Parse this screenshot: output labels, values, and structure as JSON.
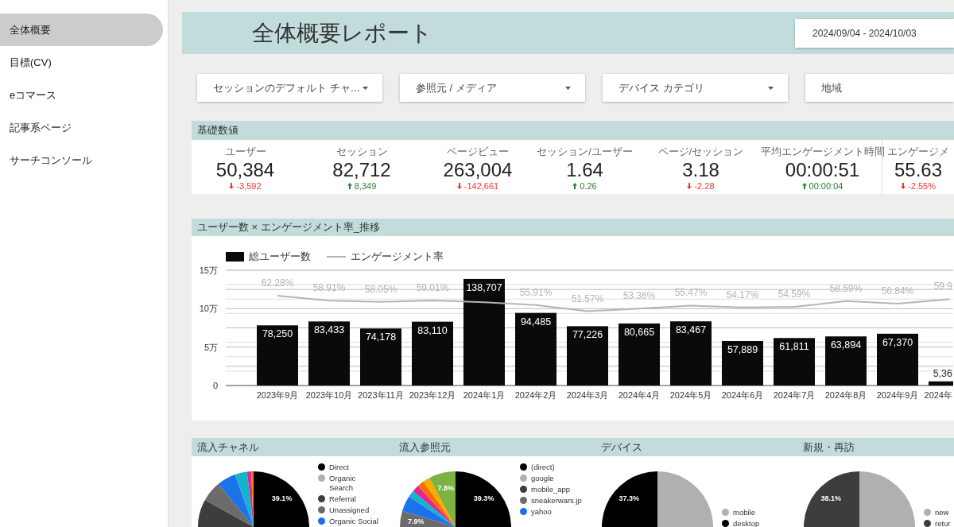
{
  "sidebar": {
    "items": [
      {
        "label": "全体概要",
        "selected": true
      },
      {
        "label": "目標(CV)",
        "selected": false
      },
      {
        "label": "eコマース",
        "selected": false
      },
      {
        "label": "記事系ページ",
        "selected": false
      },
      {
        "label": "サーチコンソール",
        "selected": false
      }
    ]
  },
  "header": {
    "title": "全体概要レポート",
    "date_range": "2024/09/04 - 2024/10/03"
  },
  "filters": [
    {
      "label": "セッションのデフォルト チャ…",
      "dropdown": true
    },
    {
      "label": "参照元 / メディア",
      "dropdown": true
    },
    {
      "label": "デバイス カテゴリ",
      "dropdown": true
    },
    {
      "label": "地域",
      "dropdown": false
    }
  ],
  "kpi": {
    "title": "基礎数値",
    "cards": [
      {
        "label": "ユーザー",
        "value": "50,384",
        "delta": "-3,592",
        "rising": false
      },
      {
        "label": "セッション",
        "value": "82,712",
        "delta": "8,349",
        "rising": true
      },
      {
        "label": "ページビュー",
        "value": "263,004",
        "delta": "-142,661",
        "rising": false
      },
      {
        "label": "セッション/ユーザー",
        "value": "1.64",
        "delta": "0.26",
        "rising": true
      },
      {
        "label": "ページ/セッション",
        "value": "3.18",
        "delta": "-2.28",
        "rising": false
      },
      {
        "label": "平均エンゲージメント時間",
        "value": "00:00:51",
        "delta": "00:00:04",
        "rising": true
      },
      {
        "label": "エンゲージメ",
        "value": "55.63",
        "delta": "-2.55%",
        "rising": false
      }
    ]
  },
  "trend": {
    "title": "ユーザー数 × エンゲージメント率_推移",
    "chart_data": {
      "type": "bar",
      "categories": [
        "2023年9月",
        "2023年10月",
        "2023年11月",
        "2023年12月",
        "2024年1月",
        "2024年2月",
        "2024年3月",
        "2024年4月",
        "2024年5月",
        "2024年6月",
        "2024年7月",
        "2024年8月",
        "2024年9月",
        "2024年"
      ],
      "ylim": [
        0,
        15
      ],
      "yticks": [
        {
          "value": 0,
          "label": "0"
        },
        {
          "value": 5,
          "label": "5万"
        },
        {
          "value": 10,
          "label": "10万"
        },
        {
          "value": 15,
          "label": "15万"
        }
      ],
      "series": [
        {
          "name": "総ユーザー数",
          "color": "#0b0909",
          "values": [
            7.83,
            8.34,
            7.42,
            8.31,
            13.87,
            9.45,
            7.72,
            8.07,
            8.35,
            5.79,
            6.18,
            6.39,
            6.74,
            0.54
          ]
        }
      ]
    },
    "bar_labels": [
      "78,250",
      "83,433",
      "74,178",
      "83,110",
      "138,707",
      "94,485",
      "77,226",
      "80,665",
      "83,467",
      "57,889",
      "61,811",
      "63,894",
      "67,370",
      "5,36"
    ],
    "line": {
      "chart_data": {
        "type": "line",
        "series": [
          {
            "name": "エンゲージメント率",
            "color": "#b5b5b5",
            "values": [
              62.28,
              58.91,
              58.05,
              59.01,
              57.8,
              55.91,
              51.57,
              53.36,
              55.47,
              54.17,
              54.59,
              58.59,
              56.84,
              59.9
            ],
            "value_labels": [
              "62.28%",
              "58.91%",
              "58.05%",
              "59.01%",
              null,
              "55.91%",
              "51.57%",
              "53.36%",
              "55.47%",
              "54.17%",
              "54.59%",
              "58.59%",
              "56.84%",
              "59.9"
            ]
          }
        ]
      }
    }
  },
  "breakdowns": [
    {
      "title": "流入チャネル",
      "legend": [
        {
          "label": "Direct",
          "color": "#000000"
        },
        {
          "label": "Organic Search",
          "color": "#b0b0b0"
        },
        {
          "label": "Referral",
          "color": "#3d3d3d"
        },
        {
          "label": "Unassigned",
          "color": "#6b6b6b"
        },
        {
          "label": "Organic Social",
          "color": "#1a73e8"
        }
      ],
      "chart_data": {
        "type": "pie",
        "values": [
          39.1,
          10.5,
          6,
          5.5,
          3.5,
          1.2,
          0.7
        ],
        "colors": [
          "#000000",
          "#3d3d3d",
          "#6b6b6b",
          "#1a73e8",
          "#12b5cb",
          "#e52592",
          "#f57c00"
        ],
        "value_labels": [
          "39.1%",
          null,
          null,
          null,
          null,
          null,
          null
        ]
      }
    },
    {
      "title": "流入参照元",
      "legend": [
        {
          "label": "(direct)",
          "color": "#000000"
        },
        {
          "label": "google",
          "color": "#b0b0b0"
        },
        {
          "label": "mobile_app",
          "color": "#3d3d3d"
        },
        {
          "label": "sneakerwars.jp",
          "color": "#6b6b6b"
        },
        {
          "label": "yahoo",
          "color": "#1a73e8"
        }
      ],
      "chart_data": {
        "type": "pie",
        "values": [
          39.3,
          7.9,
          4.5,
          2,
          2,
          2,
          2,
          7.8
        ],
        "colors": [
          "#000000",
          "#6b6b6b",
          "#1a73e8",
          "#12b5cb",
          "#e52592",
          "#f56d00",
          "#f9ab00",
          "#7cb342"
        ],
        "value_labels": [
          "39.3%",
          "7.9%",
          null,
          null,
          null,
          null,
          null,
          "7.8%"
        ]
      }
    },
    {
      "title": "デバイス",
      "legend": [
        {
          "label": "mobile",
          "color": "#b0b0b0"
        },
        {
          "label": "desktop",
          "color": "#000000"
        }
      ],
      "chart_data": {
        "type": "pie",
        "values": [
          62.2,
          37.3
        ],
        "colors": [
          "#b0b0b0",
          "#000000"
        ],
        "value_labels": [
          null,
          "37.3%"
        ]
      }
    },
    {
      "title": "新規・再訪",
      "legend": [
        {
          "label": "new",
          "color": "#b0b0b0"
        },
        {
          "label": "retur",
          "color": "#3d3d3d"
        }
      ],
      "chart_data": {
        "type": "pie",
        "values": [
          61.9,
          38.1
        ],
        "colors": [
          "#b0b0b0",
          "#3d3d3d"
        ],
        "value_labels": [
          null,
          "38.1%"
        ]
      }
    }
  ]
}
